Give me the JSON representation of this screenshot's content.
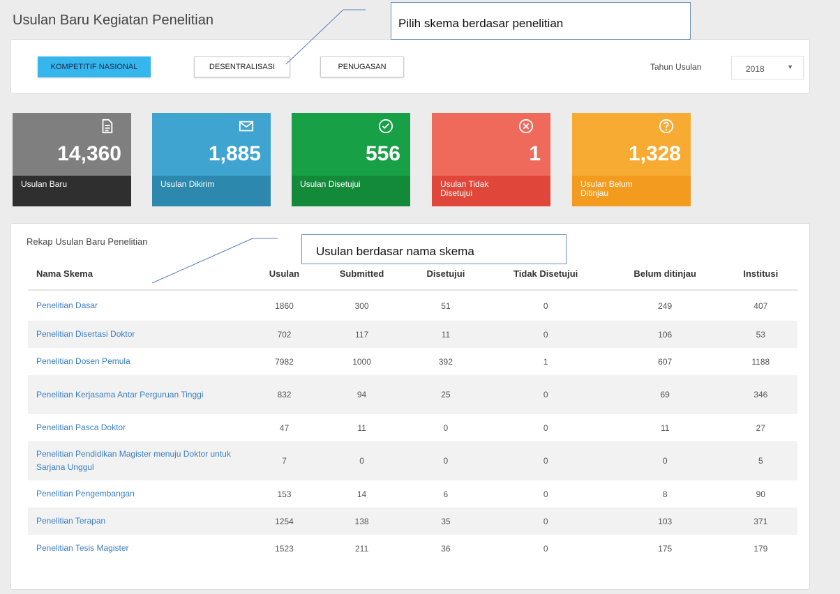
{
  "page": {
    "title": "Usulan Baru Kegiatan Penelitian"
  },
  "callouts": {
    "scheme": "Pilih skema berdasar penelitian",
    "name": "Usulan berdasar nama skema"
  },
  "schemes": {
    "buttons": [
      "KOMPETITIF NASIONAL",
      "DESENTRALISASI",
      "PENUGASAN"
    ],
    "active": "KOMPETITIF NASIONAL"
  },
  "year": {
    "label": "Tahun Usulan",
    "selected": "2018"
  },
  "stats": [
    {
      "value": "14,360",
      "label": "Usulan Baru",
      "icon": "document-icon",
      "color_top": "#7f7f7f",
      "color_bottom": "#2f2f2f"
    },
    {
      "value": "1,885",
      "label": "Usulan Dikirim",
      "icon": "envelope-icon",
      "color_top": "#3fa4cf",
      "color_bottom": "#2c88ad"
    },
    {
      "value": "556",
      "label": "Usulan Disetujui",
      "icon": "check-circle-icon",
      "color_top": "#17a046",
      "color_bottom": "#138a3a"
    },
    {
      "value": "1",
      "label": "Usulan Tidak Disetujui",
      "icon": "x-circle-icon",
      "color_top": "#ef6a5a",
      "color_bottom": "#e0473a"
    },
    {
      "value": "1,328",
      "label": "Usulan Belum Ditinjau",
      "icon": "question-circle-icon",
      "color_top": "#f8ab33",
      "color_bottom": "#f29b1e"
    }
  ],
  "recap": {
    "title": "Rekap Usulan Baru Penelitian",
    "columns": [
      "Nama Skema",
      "Usulan",
      "Submitted",
      "Disetujui",
      "Tidak Disetujui",
      "Belum ditinjau",
      "Institusi"
    ],
    "rows": [
      [
        "Penelitian Dasar",
        "1860",
        "300",
        "51",
        "0",
        "249",
        "407"
      ],
      [
        "Penelitian Disertasi Doktor",
        "702",
        "117",
        "11",
        "0",
        "106",
        "53"
      ],
      [
        "Penelitian Dosen Pemula",
        "7982",
        "1000",
        "392",
        "1",
        "607",
        "1188"
      ],
      [
        "Penelitian Kerjasama Antar Perguruan Tinggi",
        "832",
        "94",
        "25",
        "0",
        "69",
        "346"
      ],
      [
        "Penelitian Pasca Doktor",
        "47",
        "11",
        "0",
        "0",
        "11",
        "27"
      ],
      [
        "Penelitian Pendidikan Magister menuju Doktor untuk Sarjana Unggul",
        "7",
        "0",
        "0",
        "0",
        "0",
        "5"
      ],
      [
        "Penelitian Pengembangan",
        "153",
        "14",
        "6",
        "0",
        "8",
        "90"
      ],
      [
        "Penelitian Terapan",
        "1254",
        "138",
        "35",
        "0",
        "103",
        "371"
      ],
      [
        "Penelitian Tesis Magister",
        "1523",
        "211",
        "36",
        "0",
        "175",
        "179"
      ]
    ]
  }
}
